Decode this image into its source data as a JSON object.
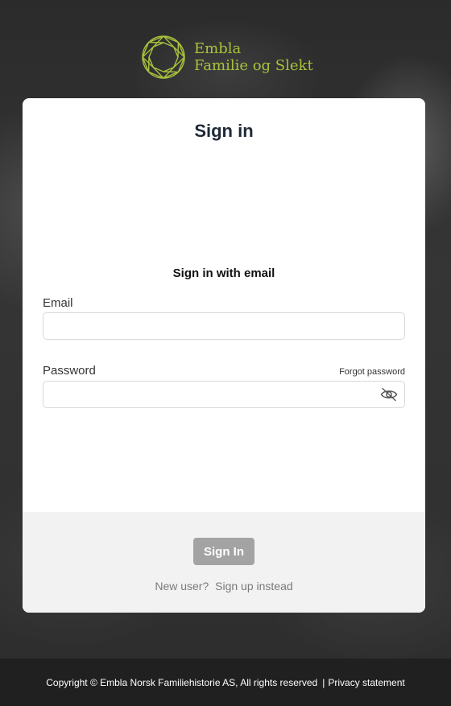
{
  "brand": {
    "name_line1": "Embla",
    "name_line2": "Familie og Slekt",
    "icon": "gem-logo-icon",
    "color": "#a8c23c"
  },
  "card": {
    "title": "Sign in",
    "email_section_heading": "Sign in with email",
    "email_label": "Email",
    "email_value": "",
    "password_label": "Password",
    "password_value": "",
    "forgot_password": "Forgot password",
    "password_toggle_icon": "eye-off-icon",
    "sign_in_button": "Sign In",
    "new_user_text": "New user?",
    "sign_up_link": "Sign up instead",
    "button_color": "#a3a3a3"
  },
  "footer": {
    "copyright": "Copyright © Embla Norsk Familiehistorie AS, All rights reserved",
    "separator": "|",
    "privacy": "Privacy statement"
  }
}
